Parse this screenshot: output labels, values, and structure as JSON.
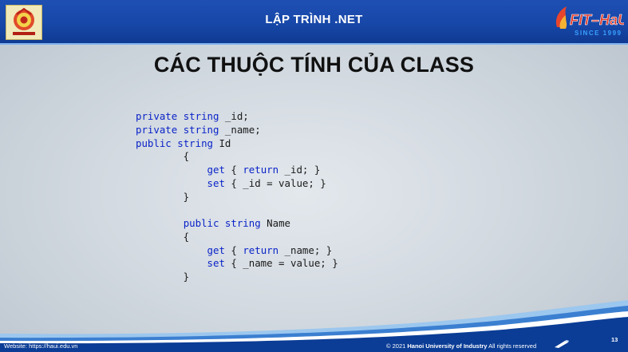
{
  "header": {
    "title": "LẬP TRÌNH .NET",
    "logo_left": "haui-university-emblem",
    "logo_right_text": "FIT-HaUI",
    "logo_right_sub": "SINCE 1999"
  },
  "slide": {
    "title": "CÁC THUỘC TÍNH CỦA CLASS",
    "code_lines": [
      "private string _id;",
      "private string _name;",
      "public string Id",
      "        {",
      "            get { return _id; }",
      "            set { _id = value; }",
      "        }",
      "",
      "        public string Name",
      "        {",
      "            get { return _name; }",
      "            set { _name = value; }",
      "        }"
    ]
  },
  "footer": {
    "website": "Website: https://haui.edu.vn",
    "copyright_prefix": "© 2021 ",
    "copyright_org": "Hanoi University of Industry",
    "copyright_suffix": " All rights reserved",
    "page_number": "13"
  },
  "colors": {
    "header_blue": "#1a4aab",
    "keyword": "#0a23c8",
    "title": "#111111"
  }
}
